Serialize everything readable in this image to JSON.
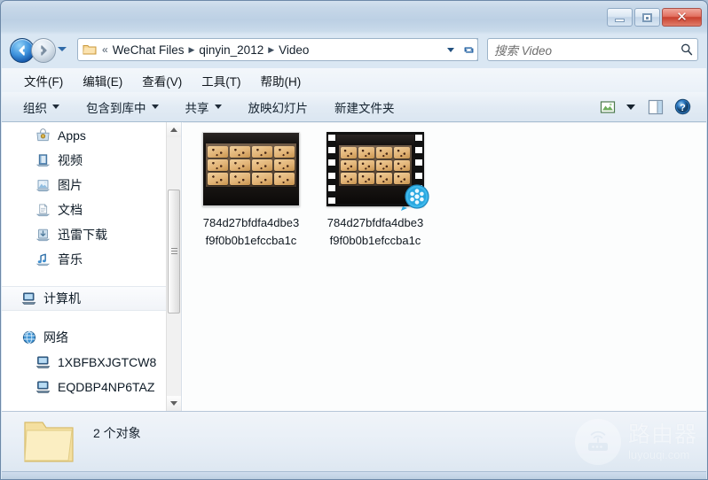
{
  "window": {
    "controls": {
      "minimize_label": "最小化",
      "maximize_label": "最大化",
      "close_label": "✕"
    }
  },
  "address_bar": {
    "back_icon": "back-arrow-icon",
    "forward_icon": "forward-arrow-icon",
    "history_dropdown_icon": "chevron-down-icon",
    "folder_icon": "folder-icon",
    "chevrons": "«",
    "separator": "▶",
    "crumbs": [
      {
        "label": "WeChat Files"
      },
      {
        "label": "qinyin_2012"
      },
      {
        "label": "Video"
      }
    ],
    "refresh_icon": "refresh-icon",
    "dropdown_icon": "chevron-down-icon"
  },
  "search": {
    "placeholder": "搜索 Video",
    "value": "",
    "icon": "search-icon"
  },
  "menu": {
    "items": [
      {
        "label": "文件(F)"
      },
      {
        "label": "编辑(E)"
      },
      {
        "label": "查看(V)"
      },
      {
        "label": "工具(T)"
      },
      {
        "label": "帮助(H)"
      }
    ]
  },
  "toolbar": {
    "buttons": [
      {
        "label": "组织",
        "has_caret": true
      },
      {
        "label": "包含到库中",
        "has_caret": true
      },
      {
        "label": "共享",
        "has_caret": true
      },
      {
        "label": "放映幻灯片",
        "has_caret": false
      },
      {
        "label": "新建文件夹",
        "has_caret": false
      }
    ],
    "view_icon": "view-layout-icon",
    "view_caret_icon": "chevron-down-icon",
    "preview_pane_icon": "preview-pane-icon",
    "help_icon": "help-icon"
  },
  "sidebar": {
    "items": [
      {
        "label": "Apps",
        "icon": "apps-folder-icon",
        "level": "child",
        "selected": false
      },
      {
        "label": "视频",
        "icon": "video-library-icon",
        "level": "child",
        "selected": false
      },
      {
        "label": "图片",
        "icon": "pictures-library-icon",
        "level": "child",
        "selected": false
      },
      {
        "label": "文档",
        "icon": "documents-library-icon",
        "level": "child",
        "selected": false
      },
      {
        "label": "迅雷下载",
        "icon": "downloads-library-icon",
        "level": "child",
        "selected": false
      },
      {
        "label": "音乐",
        "icon": "music-library-icon",
        "level": "child",
        "selected": false
      },
      {
        "label": "计算机",
        "icon": "computer-icon",
        "level": "root",
        "selected": true
      },
      {
        "label": "网络",
        "icon": "network-icon",
        "level": "root",
        "selected": false
      },
      {
        "label": "1XBFBXJGTCW8",
        "icon": "network-computer-icon",
        "level": "child",
        "selected": false
      },
      {
        "label": "EQDBP4NP6TAZ",
        "icon": "network-computer-icon",
        "level": "child",
        "selected": false
      }
    ],
    "scrollbar": {
      "up_icon": "scroll-up-icon",
      "down_icon": "scroll-down-icon"
    }
  },
  "files": {
    "items": [
      {
        "name": "784d27bfdfa4dbe3f9f0b0b1efccba1c",
        "type": "image",
        "thumbnail_description": "cookies-on-baking-tray-photo"
      },
      {
        "name": "784d27bfdfa4dbe3f9f0b0b1efccba1c",
        "type": "video",
        "thumbnail_description": "cookies-on-baking-tray-video",
        "badge_icon": "film-reel-icon"
      }
    ]
  },
  "status": {
    "folder_icon": "folder-icon",
    "count_text": "2 个对象"
  },
  "watermark": {
    "icon": "router-icon",
    "title": "路由器",
    "site": "luyouqi.com"
  },
  "colors": {
    "accent_blue": "#1456a8",
    "close_red": "#c9402e",
    "frame_border": "#6d89a8",
    "video_badge": "#2aa8e0"
  }
}
